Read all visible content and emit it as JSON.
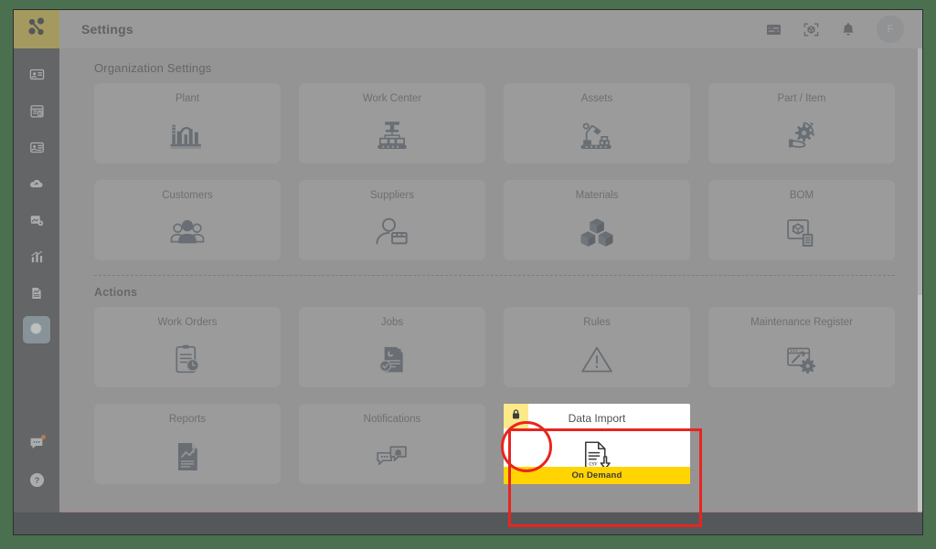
{
  "window": {
    "outer_bg": "#4a7050",
    "frame_bg": "#ababab"
  },
  "sidebar": {
    "brand": {
      "icon": "network-nodes-icon",
      "bg": "#c4b14f"
    },
    "items": [
      {
        "id": "address-book",
        "icon": "id-card-icon",
        "active": false
      },
      {
        "id": "schedule",
        "icon": "calendar-clock-icon",
        "active": false
      },
      {
        "id": "production",
        "icon": "machine-panel-icon",
        "active": false
      },
      {
        "id": "cloud",
        "icon": "cloud-icon",
        "active": false
      },
      {
        "id": "analytics-edit",
        "icon": "image-gear-icon",
        "active": false
      },
      {
        "id": "charts",
        "icon": "bar-chart-icon",
        "active": false
      },
      {
        "id": "documents",
        "icon": "report-doc-icon",
        "active": false
      },
      {
        "id": "settings",
        "icon": "gear-icon",
        "active": true
      }
    ],
    "bottom_items": [
      {
        "id": "chat",
        "icon": "chat-bubble-icon",
        "badge": true
      },
      {
        "id": "help",
        "icon": "question-circle-icon",
        "badge": false
      }
    ],
    "active_bg": "#93a7b0"
  },
  "header": {
    "title": "Settings",
    "icons": [
      {
        "id": "panel-sliders",
        "name": "sliders-panel-icon"
      },
      {
        "id": "scan-3d",
        "name": "scan-cube-icon"
      },
      {
        "id": "notifications",
        "name": "bell-icon"
      }
    ],
    "avatar": {
      "initial": "F",
      "name": "user-avatar"
    }
  },
  "sections": [
    {
      "id": "organization-settings",
      "title": "Organization Settings",
      "cards": [
        {
          "id": "plant",
          "label": "Plant",
          "icon": "factory-icon"
        },
        {
          "id": "work-center",
          "label": "Work Center",
          "icon": "conveyor-press-icon"
        },
        {
          "id": "assets",
          "label": "Assets",
          "icon": "robot-arm-conveyor-icon"
        },
        {
          "id": "part-item",
          "label": "Part / Item",
          "icon": "hand-gear-icon"
        },
        {
          "id": "customers",
          "label": "Customers",
          "icon": "people-group-icon"
        },
        {
          "id": "suppliers",
          "label": "Suppliers",
          "icon": "person-box-icon"
        },
        {
          "id": "materials",
          "label": "Materials",
          "icon": "boxes-icon"
        },
        {
          "id": "bom",
          "label": "BOM",
          "icon": "cube-document-icon"
        }
      ]
    },
    {
      "id": "actions",
      "title": "Actions",
      "cards": [
        {
          "id": "work-orders",
          "label": "Work Orders",
          "icon": "clipboard-clock-icon"
        },
        {
          "id": "jobs",
          "label": "Jobs",
          "icon": "chart-doc-check-icon"
        },
        {
          "id": "rules",
          "label": "Rules",
          "icon": "warning-triangle-icon"
        },
        {
          "id": "maintenance-register",
          "label": "Maintenance Register",
          "icon": "window-wrench-gear-icon"
        },
        {
          "id": "reports",
          "label": "Reports",
          "icon": "report-chart-doc-icon"
        },
        {
          "id": "notifications",
          "label": "Notifications",
          "icon": "chat-bell-icon"
        }
      ]
    }
  ],
  "data_import": {
    "label": "Data Import",
    "icon": "csv-download-icon",
    "locked": true,
    "lock_icon": "padlock-icon",
    "lock_badge_color": "#fbe98a",
    "footer_label": "On Demand",
    "footer_color": "#ffd400",
    "highlight_color": "#e8251f"
  }
}
